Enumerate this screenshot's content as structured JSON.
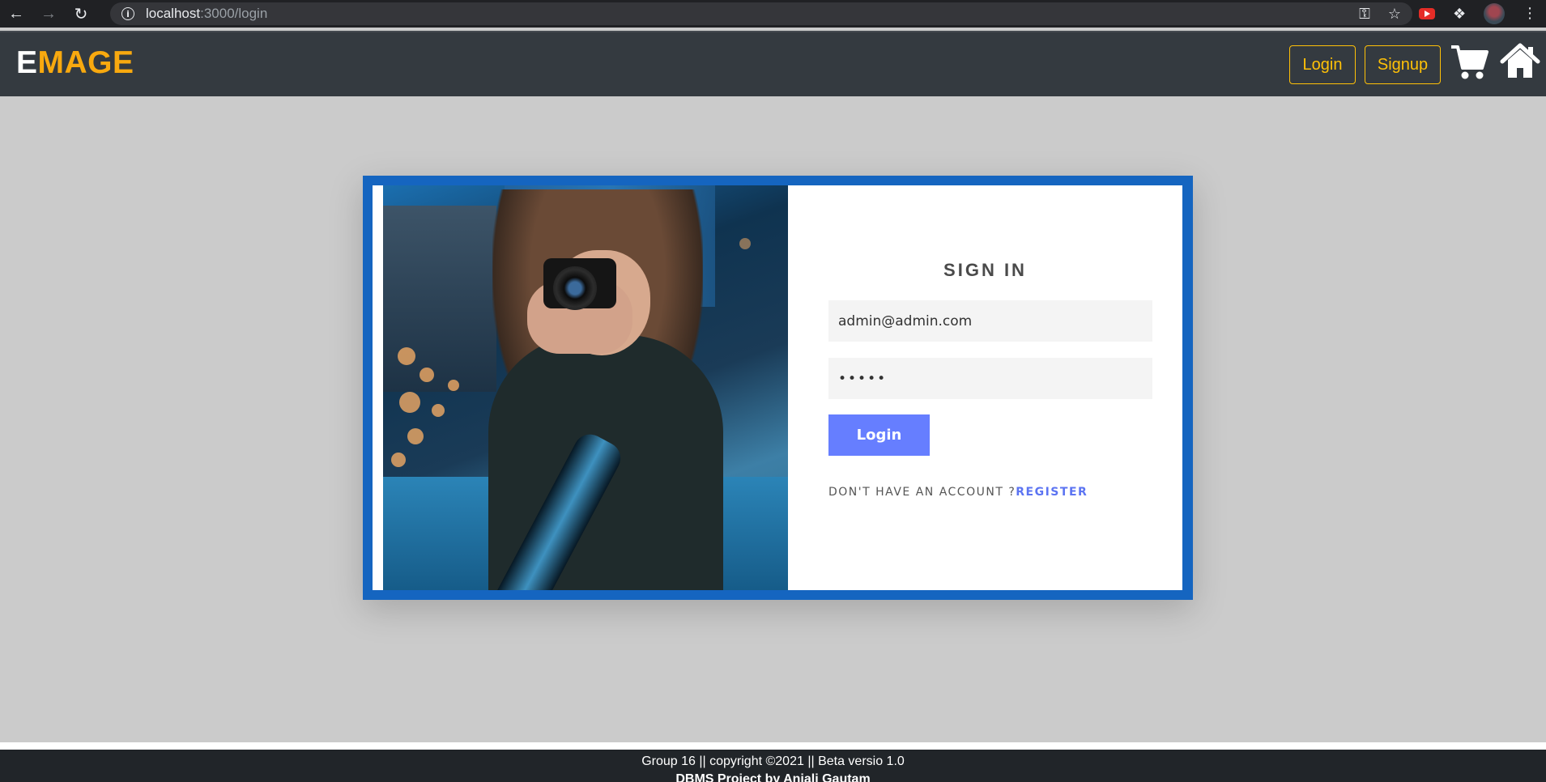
{
  "browser": {
    "url_host": "localhost",
    "url_path": ":3000/login",
    "info_icon": "i"
  },
  "header": {
    "logo_first": "E",
    "logo_rest": "MAGE",
    "login_label": "Login",
    "signup_label": "Signup",
    "accent_color": "#ffc107",
    "logo_color": "#f8a90f"
  },
  "login_form": {
    "title": "SIGN IN",
    "email_value": "admin@admin.com",
    "password_value": "admin",
    "submit_label": "Login",
    "no_account_text": "DON'T HAVE AN ACCOUNT ?",
    "register_label": "REGISTER",
    "frame_color": "#1565c0",
    "button_color": "#667eff"
  },
  "footer": {
    "line1": "Group 16 || copyright ©2021 || Beta versio 1.0",
    "line2": "DBMS Project by Anjali Gautam"
  }
}
